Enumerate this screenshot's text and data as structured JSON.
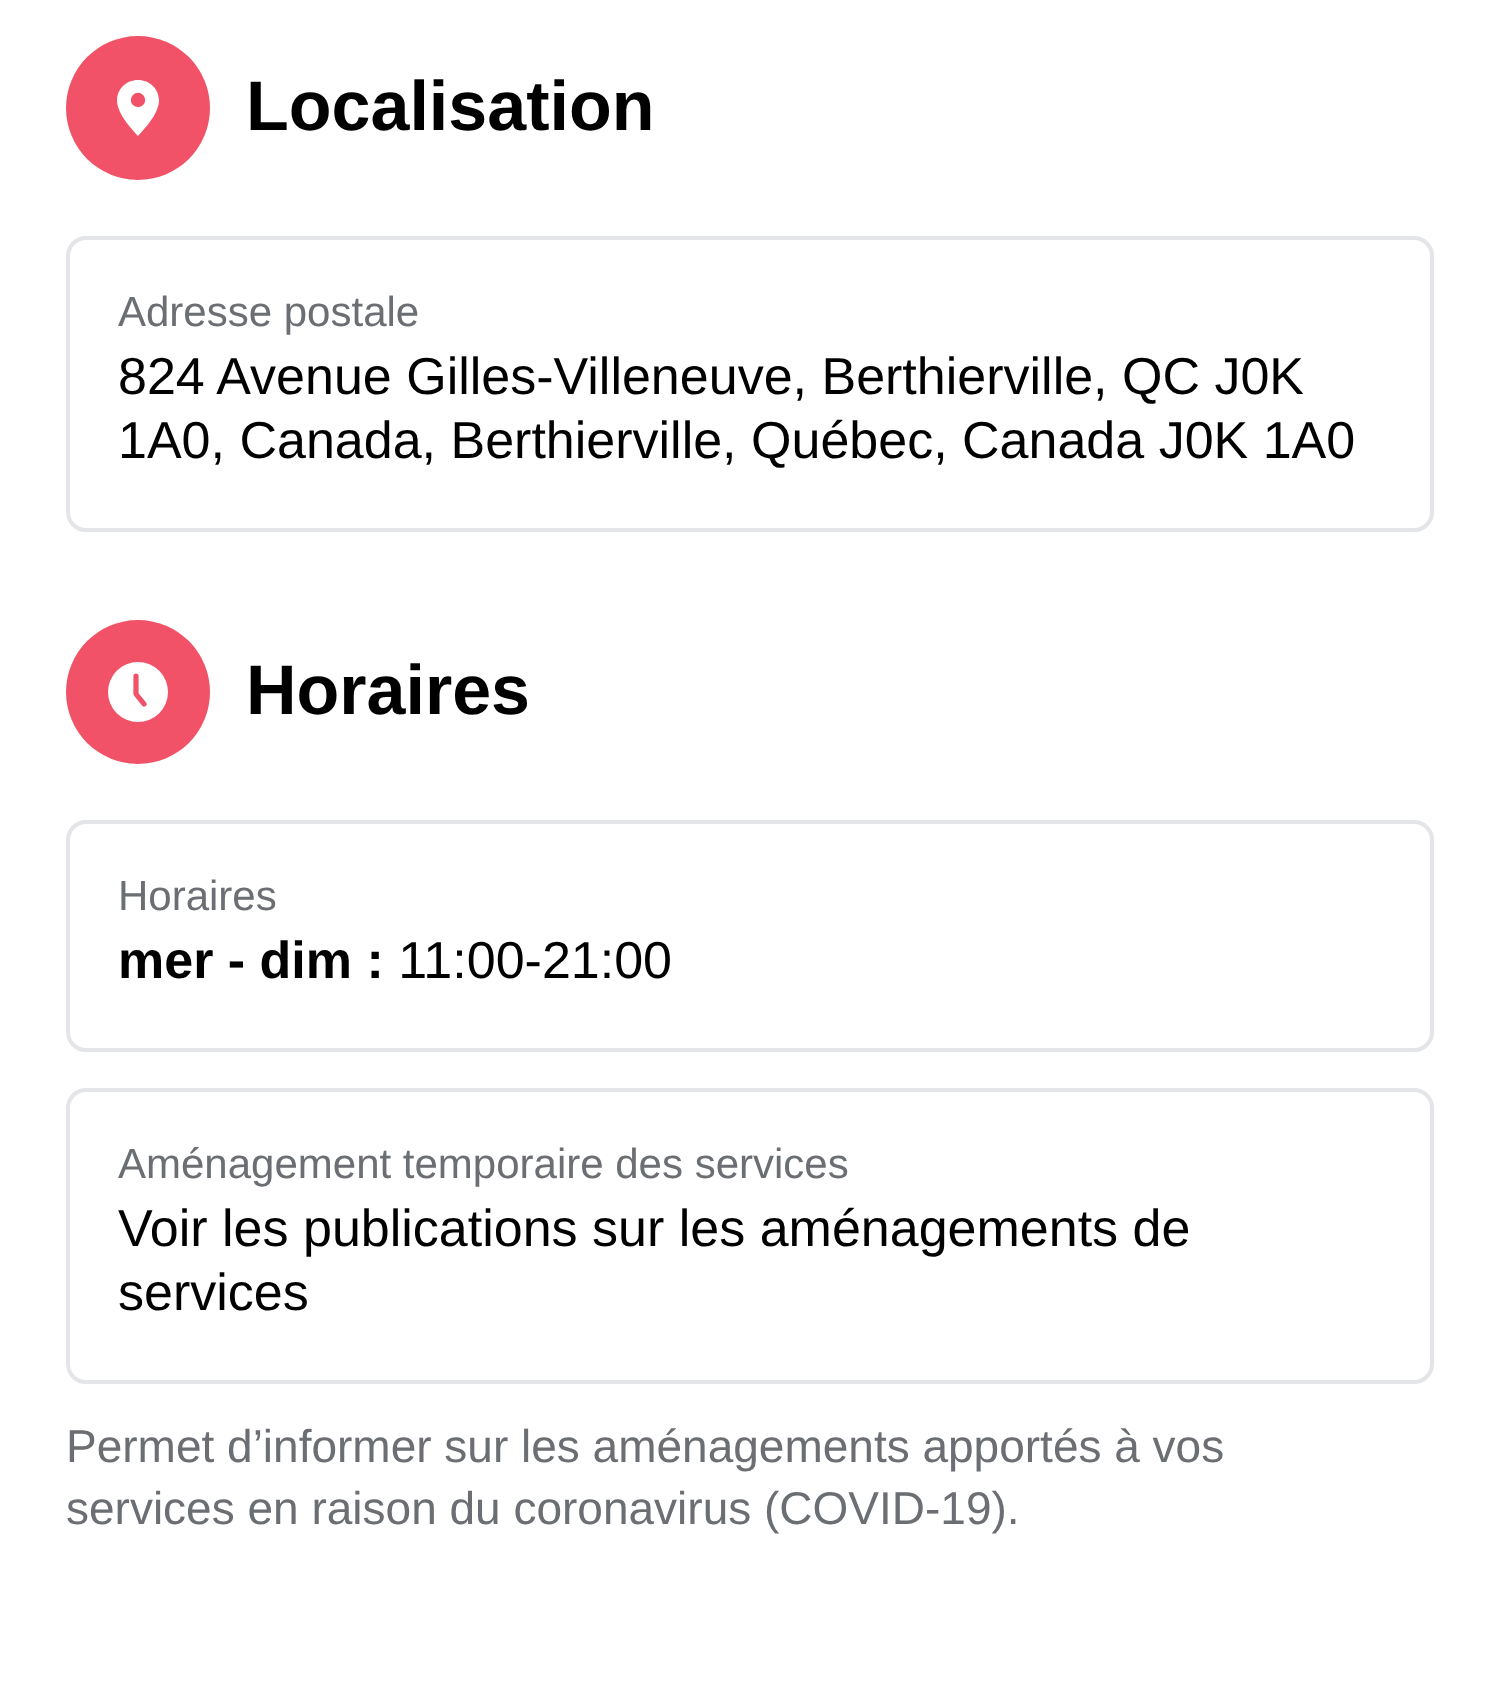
{
  "sections": [
    {
      "kind": "location",
      "title": "Localisation",
      "cards": [
        {
          "label": "Adresse postale",
          "value": "824 Avenue Gilles-Villeneuve, Berthierville, QC J0K 1A0, Canada, Berthierville, Québec, Canada J0K 1A0"
        }
      ]
    },
    {
      "kind": "hours",
      "title": "Horaires",
      "cards": [
        {
          "label": "Horaires",
          "value": "**mer - dim :** 11:00-21:00"
        },
        {
          "label": "Aménagement temporaire des services",
          "value": "Voir les publications sur les aménagements de services"
        }
      ]
    }
  ],
  "note": "Permet d’informer sur les aménagements apportés à vos services en raison du coronavirus (COVID-19)."
}
